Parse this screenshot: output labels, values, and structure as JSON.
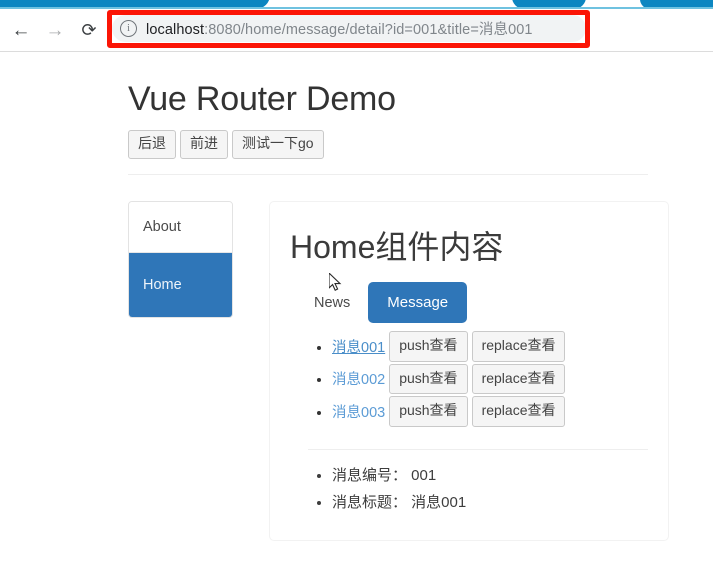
{
  "browser": {
    "back_icon": "back-arrow-icon",
    "forward_icon": "forward-arrow-icon",
    "reload_icon": "reload-icon",
    "info_icon": "ⓘ",
    "url_host": "localhost",
    "url_rest": ":8080/home/message/detail?id=001&title=消息001",
    "url_full": "localhost:8080/home/message/detail?id=001&title=消息001",
    "tab_strip_color": "#0c86c1"
  },
  "annotation": {
    "color": "#fb1506",
    "target": "address-bar"
  },
  "header": {
    "title": "Vue Router Demo",
    "buttons": [
      {
        "label": "后退"
      },
      {
        "label": "前进"
      },
      {
        "label": "测试一下go"
      }
    ]
  },
  "sidebar": {
    "items": [
      {
        "label": "About",
        "active": false
      },
      {
        "label": "Home",
        "active": true
      }
    ],
    "active_color": "#2f76b8"
  },
  "main": {
    "title": "Home组件内容",
    "tabs": [
      {
        "label": "News",
        "active": false
      },
      {
        "label": "Message",
        "active": true
      }
    ],
    "messages": [
      {
        "link": "消息001",
        "push_label": "push查看",
        "replace_label": "replace查看",
        "hovered": true
      },
      {
        "link": "消息002",
        "push_label": "push查看",
        "replace_label": "replace查看",
        "hovered": false
      },
      {
        "link": "消息003",
        "push_label": "push查看",
        "replace_label": "replace查看",
        "hovered": false
      }
    ],
    "detail": [
      {
        "text": "消息编号： 001"
      },
      {
        "text": "消息标题： 消息001"
      }
    ]
  }
}
